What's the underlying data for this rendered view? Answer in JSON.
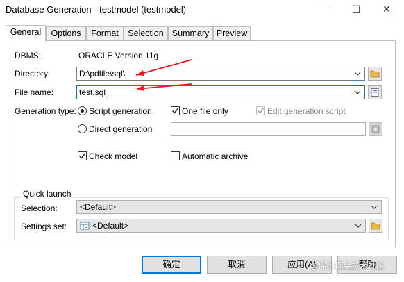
{
  "window": {
    "title": "Database Generation - testmodel (testmodel)",
    "minimize_glyph": "—",
    "maximize_glyph": "☐",
    "close_glyph": "✕"
  },
  "tabs": [
    {
      "label": "General",
      "active": true
    },
    {
      "label": "Options",
      "active": false
    },
    {
      "label": "Format",
      "active": false
    },
    {
      "label": "Selection",
      "active": false
    },
    {
      "label": "Summary",
      "active": false
    },
    {
      "label": "Preview",
      "active": false
    }
  ],
  "general": {
    "dbms_label": "DBMS:",
    "dbms_value": "ORACLE Version 11g",
    "directory_label": "Directory:",
    "directory_value": "D:\\pdfile\\sql\\",
    "filename_label": "File name:",
    "filename_value": "test.sql",
    "generation_type_label": "Generation type:",
    "script_generation_label": "Script generation",
    "script_generation_selected": true,
    "direct_generation_label": "Direct generation",
    "direct_generation_selected": false,
    "one_file_only_label": "One file only",
    "one_file_only_checked": true,
    "edit_script_label": "Edit generation script",
    "edit_script_checked": true,
    "edit_script_enabled": false,
    "direct_value": "",
    "check_model_label": "Check model",
    "check_model_checked": true,
    "automatic_archive_label": "Automatic archive",
    "automatic_archive_checked": false
  },
  "quick_launch": {
    "title": "Quick launch",
    "selection_label": "Selection:",
    "selection_value": "<Default>",
    "settings_label": "Settings set:",
    "settings_value": "<Default>"
  },
  "buttons": {
    "ok": "确定",
    "cancel": "取消",
    "apply": "应用(A)",
    "help": "帮助"
  },
  "watermark": "@稀土掘金技术社区",
  "colors": {
    "arrow": "#e8161d",
    "focus": "#0078d7",
    "folder": "#e8b84a"
  },
  "icons": {
    "folder": "folder-icon",
    "properties": "properties-icon",
    "disabled_button": "disabled-icon",
    "settings_set": "settings-set-icon"
  }
}
